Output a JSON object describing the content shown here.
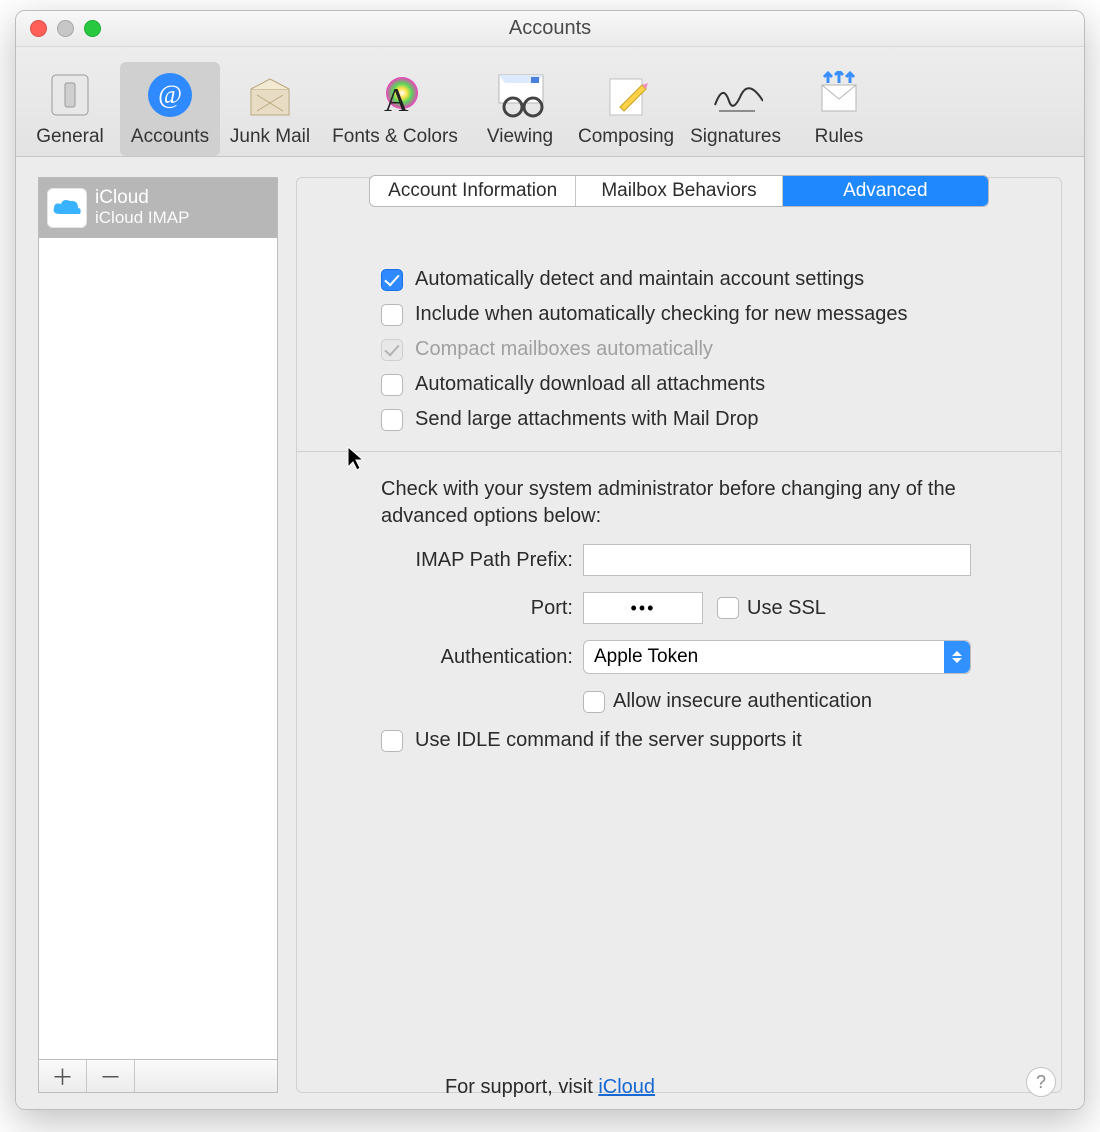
{
  "title": "Accounts",
  "toolbar": [
    {
      "id": "general",
      "label": "General"
    },
    {
      "id": "accounts",
      "label": "Accounts"
    },
    {
      "id": "junk",
      "label": "Junk Mail"
    },
    {
      "id": "fonts",
      "label": "Fonts & Colors"
    },
    {
      "id": "viewing",
      "label": "Viewing"
    },
    {
      "id": "composing",
      "label": "Composing"
    },
    {
      "id": "signatures",
      "label": "Signatures"
    },
    {
      "id": "rules",
      "label": "Rules"
    }
  ],
  "activeToolbar": "accounts",
  "sidebar": {
    "account": {
      "name": "iCloud",
      "sub": "iCloud IMAP"
    }
  },
  "tabs": [
    "Account Information",
    "Mailbox Behaviors",
    "Advanced"
  ],
  "activeTab": "Advanced",
  "checks": {
    "auto_detect": {
      "label": "Automatically detect and maintain account settings",
      "checked": true,
      "disabled": false
    },
    "include_check": {
      "label": "Include when automatically checking for new messages",
      "checked": false,
      "disabled": false
    },
    "compact": {
      "label": "Compact mailboxes automatically",
      "checked": true,
      "disabled": true
    },
    "download_attach": {
      "label": "Automatically download all attachments",
      "checked": false,
      "disabled": false
    },
    "mail_drop": {
      "label": "Send large attachments with Mail Drop",
      "checked": false,
      "disabled": false
    }
  },
  "advNote": "Check with your system administrator before changing any of the advanced options below:",
  "form": {
    "imap_prefix": {
      "label": "IMAP Path Prefix:",
      "value": ""
    },
    "port": {
      "label": "Port:",
      "value": "•••"
    },
    "use_ssl": {
      "label": "Use SSL",
      "checked": false
    },
    "auth": {
      "label": "Authentication:",
      "value": "Apple Token"
    },
    "allow_insecure": {
      "label": "Allow insecure authentication",
      "checked": false
    },
    "use_idle": {
      "label": "Use IDLE command if the server supports it",
      "checked": false
    }
  },
  "footer": {
    "prefix": "For support, visit ",
    "link": "iCloud"
  }
}
